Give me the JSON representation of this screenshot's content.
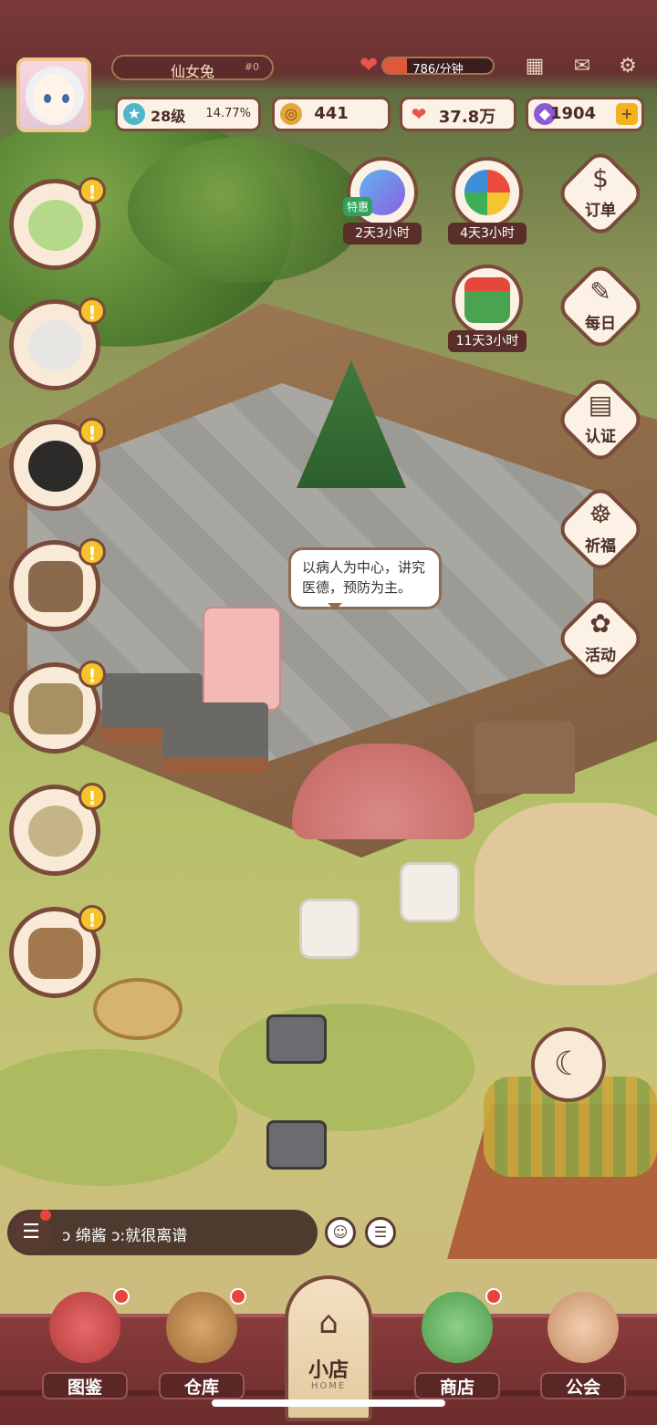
{
  "player": {
    "name": "仙女兔",
    "rank": "#0",
    "level": "28级",
    "level_progress": "14.77%",
    "energy_rate": "786/分钟",
    "energy_fill": 0.22
  },
  "resources": {
    "coins": "441",
    "hearts": "37.8万",
    "gems": "1904"
  },
  "events": [
    {
      "timer": "2天3小时",
      "tag": "特惠",
      "icon": "gift-box-icon"
    },
    {
      "timer": "4天3小时",
      "icon": "spin-wheel-icon"
    },
    {
      "timer": "11天3小时",
      "icon": "christmas-list-icon"
    }
  ],
  "right_menu": [
    {
      "label": "订单",
      "icon": "order-icon"
    },
    {
      "label": "每日",
      "icon": "daily-icon"
    },
    {
      "label": "认证",
      "icon": "certification-icon"
    },
    {
      "label": "祈福",
      "icon": "prayer-icon"
    },
    {
      "label": "活动",
      "icon": "activity-icon"
    }
  ],
  "left_quests": [
    {
      "icon": "dish-quest-icon"
    },
    {
      "icon": "old-man-quest-icon"
    },
    {
      "icon": "glasses-man-quest-icon"
    },
    {
      "icon": "tv-quest-icon"
    },
    {
      "icon": "stall-quest-icon"
    },
    {
      "icon": "pot-quest-icon"
    },
    {
      "icon": "bathtub-quest-icon"
    }
  ],
  "speech": "以病人为中心，讲究医德，预防为主。",
  "chat": {
    "message": "ↄ 绵酱 ↄ:就很离谱"
  },
  "bottom_nav": [
    {
      "label": "图鉴",
      "icon": "book-icon",
      "badge": true
    },
    {
      "label": "仓库",
      "icon": "warehouse-icon",
      "badge": true
    },
    {
      "label": "商店",
      "icon": "shop-icon",
      "badge": true
    },
    {
      "label": "公会",
      "icon": "guild-icon",
      "badge": false
    }
  ],
  "home": {
    "label": "小店",
    "sub": "HOME"
  },
  "colors": {
    "topbar": "#6a3131",
    "panel": "#fbf1e4",
    "border": "#7a4a3a",
    "alert": "#f6c32c"
  }
}
